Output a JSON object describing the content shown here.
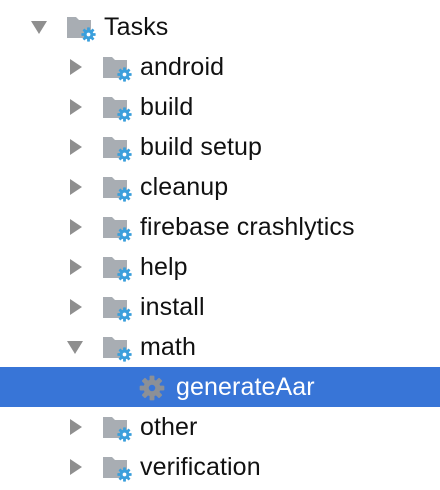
{
  "colors": {
    "selection": "#3875d7",
    "folder_gray": "#a8adb3",
    "gear_blue": "#3a9fdc",
    "gear_gray": "#8c9096",
    "arrow_gray": "#8f8f8f"
  },
  "tree": {
    "root": {
      "label": "Tasks",
      "expanded": true,
      "icon": "task-folder-icon"
    },
    "groups": [
      {
        "label": "android",
        "expanded": false,
        "icon": "task-folder-icon"
      },
      {
        "label": "build",
        "expanded": false,
        "icon": "task-folder-icon"
      },
      {
        "label": "build setup",
        "expanded": false,
        "icon": "task-folder-icon"
      },
      {
        "label": "cleanup",
        "expanded": false,
        "icon": "task-folder-icon"
      },
      {
        "label": "firebase crashlytics",
        "expanded": false,
        "icon": "task-folder-icon"
      },
      {
        "label": "help",
        "expanded": false,
        "icon": "task-folder-icon"
      },
      {
        "label": "install",
        "expanded": false,
        "icon": "task-folder-icon"
      },
      {
        "label": "math",
        "expanded": true,
        "icon": "task-folder-icon",
        "children": [
          {
            "label": "generateAar",
            "selected": true,
            "icon": "gear-icon"
          }
        ]
      },
      {
        "label": "other",
        "expanded": false,
        "icon": "task-folder-icon"
      },
      {
        "label": "verification",
        "expanded": false,
        "icon": "task-folder-icon"
      }
    ]
  }
}
